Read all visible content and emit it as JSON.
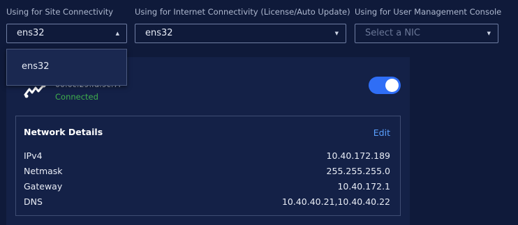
{
  "labels": {
    "site": "Using for Site Connectivity",
    "internet": "Using for Internet Connectivity (License/Auto Update)",
    "ums": "Using for User Management Console"
  },
  "selects": {
    "site": {
      "value": "ens32"
    },
    "internet": {
      "value": "ens32"
    },
    "ums": {
      "placeholder": "Select a NIC"
    }
  },
  "dropdown": {
    "options": [
      "ens32"
    ]
  },
  "nic": {
    "mac": "00:0c:29:fd:9c:7f",
    "status": "Connected",
    "status_color": "#3fae4d",
    "enabled": true,
    "toggle_color": "#2f6ef6"
  },
  "network_details": {
    "title": "Network Details",
    "edit_label": "Edit",
    "rows": [
      {
        "key": "IPv4",
        "value": "10.40.172.189"
      },
      {
        "key": "Netmask",
        "value": "255.255.255.0"
      },
      {
        "key": "Gateway",
        "value": "10.40.172.1"
      },
      {
        "key": "DNS",
        "value": "10.40.40.21,10.40.40.22"
      }
    ]
  }
}
